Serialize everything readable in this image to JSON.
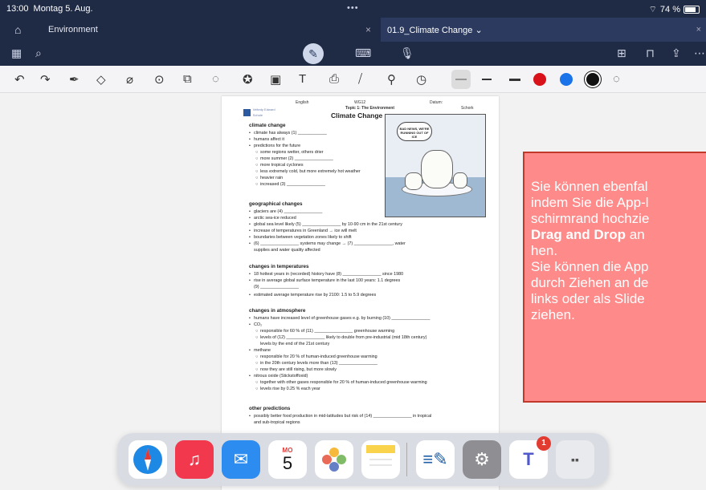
{
  "status": {
    "time": "13:00",
    "date": "Montag 5. Aug.",
    "dots": "•••",
    "battery": "74 %"
  },
  "tabs": {
    "home_icon": "home-icon",
    "environment": "Environment",
    "close": "×",
    "active": "01.9_Climate Change ⌄"
  },
  "document": {
    "header_left": "English",
    "header_mid": "WG12",
    "header_right": "Datum:",
    "topic": "Topic 1: The Environment",
    "school": "Schork",
    "title": "Climate Change",
    "logo_text": "Veltedy Edward Schule",
    "comic_text": "BAD NEWS, WE'RE RUNNING OUT OF ICE",
    "sections": [
      {
        "heading": "climate change",
        "lines": [
          "climate has always (1) ____________",
          "humans affect it",
          "predictions for the future",
          "some regions wetter, others drier",
          "more summer (2) ________________",
          "more tropical cyclones",
          "less extremely cold, but more extremely hot weather",
          "heavier rain",
          "increased (3) ________________"
        ]
      },
      {
        "heading": "geographical changes",
        "lines": [
          "glaciers are (4) ________________",
          "arctic sea-ice reduced",
          "global sea level likely (5) ________________ by 10-90 cm in the 21st century",
          "increase of temperatures in Greenland → ice will melt",
          "boundaries between vegetation zones likely to shift",
          "(6) ________________ systems may change → (7) ________________, water",
          "supplies and water quality affected"
        ]
      },
      {
        "heading": "changes in temperatures",
        "lines": [
          "18 hottest years in (recorded) history have (8) ________________ since 1980",
          "rise in average global surface temperature in the last 100 years: 1.1 degrees",
          "(9) ________________",
          "estimated average temperature rise by 2100: 1.5 to 5.9 degrees"
        ]
      },
      {
        "heading": "changes in atmosphere",
        "lines": [
          "humans have increased level of greenhouse gases e.g. by burning (10) ________________",
          "CO₂",
          "responsible for 60 % of (11) ________________ greenhouse warming",
          "levels of (12) ________________ likely to double from pre-industrial (mid 18th century)",
          "levels by the end of the 21st century",
          "methane",
          "responsible for 20 % of human-induced greenhouse warming",
          "in the 20th century levels more than (13) ________________",
          "now they are still rising, but more slowly",
          "nitrous oxide (Stickstoffoxid)",
          "together with other gases responsible for 20 % of human-induced greenhouse warming",
          "levels rise by 0.25 % each year"
        ]
      },
      {
        "heading": "other predictions",
        "lines": [
          "possibly better food production in mid-latitudes but risk of (14) ________________ in tropical",
          "and sub-tropical regions"
        ]
      }
    ]
  },
  "note": {
    "l1": "Sie können ebenfal",
    "l2": "indem Sie die App-l",
    "l3": "schirmrand hochzie",
    "l4_bold": "Drag and Drop",
    "l4_rest": " an",
    "l5": "hen.",
    "l6": "Sie können die App",
    "l7": "durch Ziehen an de",
    "l8": "links oder als Slide",
    "l9": "ziehen."
  },
  "dock": {
    "calendar_day": "MO",
    "calendar_date": "5",
    "teams_badge": "1"
  },
  "colors": {
    "bg_dark": "#1f2a44",
    "note_bg": "#ff8a8a",
    "note_border": "#c0392b"
  }
}
